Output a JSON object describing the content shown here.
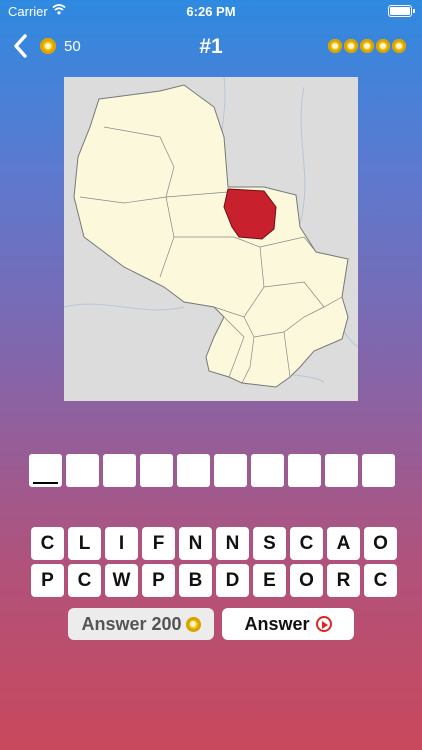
{
  "status": {
    "carrier": "Carrier",
    "time": "6:26 PM"
  },
  "header": {
    "coins": "50",
    "title": "#1",
    "progress_count": 5
  },
  "map": {
    "highlight_color": "#c8202c",
    "land_color": "#fbf8dc",
    "water_color": "#dcdcdc"
  },
  "answer": {
    "slots": 10,
    "letters": [
      "",
      "",
      "",
      "",
      "",
      "",
      "",
      "",
      "",
      ""
    ]
  },
  "keyboard": {
    "row1": [
      "C",
      "L",
      "I",
      "F",
      "N",
      "N",
      "S",
      "C",
      "A",
      "O"
    ],
    "row2": [
      "P",
      "C",
      "W",
      "P",
      "B",
      "D",
      "E",
      "O",
      "R",
      "C"
    ]
  },
  "buttons": {
    "answer_coins_label": "Answer 200",
    "answer_video_label": "Answer"
  }
}
